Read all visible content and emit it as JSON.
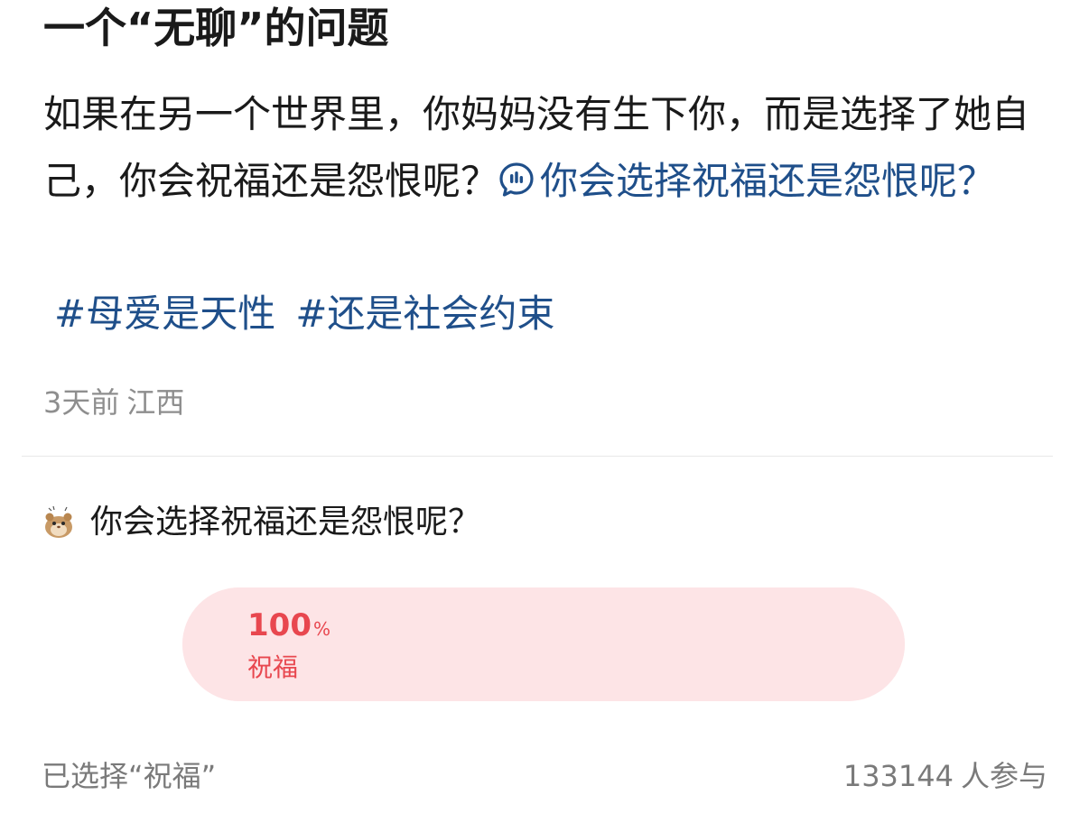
{
  "post": {
    "title": "一个“无聊”的问题",
    "body_text": "如果在另一个世界里，你妈妈没有生下你，而是选择了她自己，你会祝福还是怨恨呢？",
    "topic_icon": "topic-bubble-icon",
    "topic_link": "你会选择祝福还是怨恨呢？",
    "hashtags": [
      "#母爱是天性",
      "#还是社会约束"
    ],
    "time": "3天前",
    "location": "江西"
  },
  "poll": {
    "avatar_icon": "hamster-avatar-icon",
    "question": "你会选择祝福还是怨恨呢？",
    "options": [
      {
        "percent": "100",
        "percent_sign": "%",
        "label": "祝福",
        "fill_fraction": 1.0
      }
    ],
    "status": "已选择“祝福”",
    "participant_count": "133144",
    "participant_suffix": "人参与"
  },
  "colors": {
    "text": "#1a1a1a",
    "link": "#1f4f8a",
    "meta": "#8e8e8e",
    "poll_accent": "#e8474f",
    "poll_bg": "#fde9ea"
  }
}
